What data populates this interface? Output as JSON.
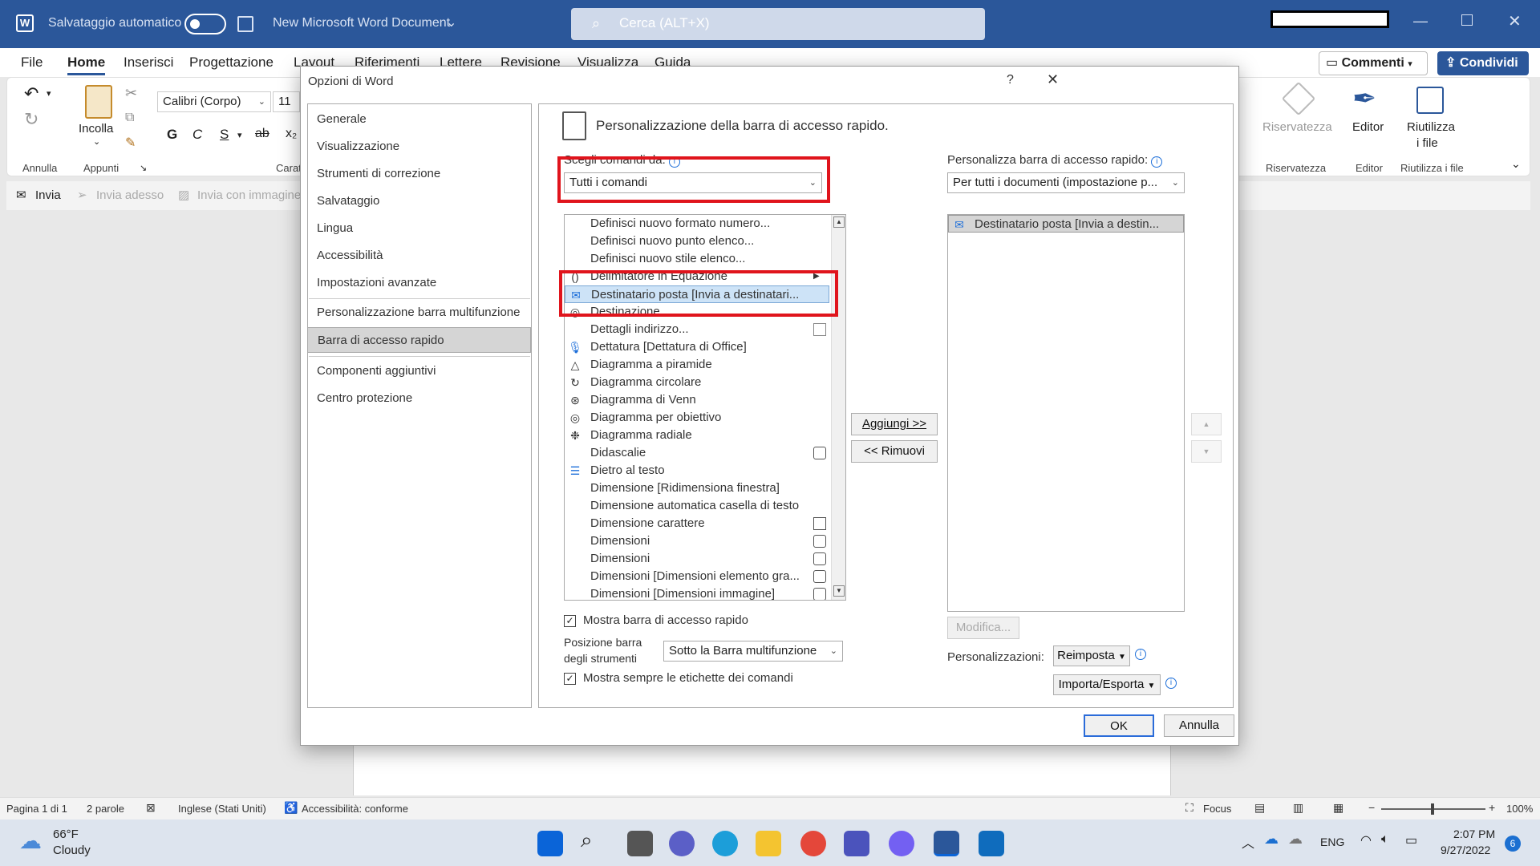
{
  "titlebar": {
    "autosave_label": "Salvataggio automatico",
    "doc_title": "New Microsoft Word Document",
    "search_placeholder": "Cerca (ALT+X)"
  },
  "tabs": [
    "File",
    "Home",
    "Inserisci",
    "Progettazione",
    "Layout",
    "Riferimenti",
    "Lettere",
    "Revisione",
    "Visualizza",
    "Guida"
  ],
  "ribbon": {
    "comments": "Commenti",
    "share": "Condividi",
    "undo_group": "Annulla",
    "paste": "Incolla",
    "clipboard_group": "Appunti",
    "font_name": "Calibri (Corpo)",
    "font_size": "11",
    "font_group_short": "Carat",
    "privacy": "Riservatezza",
    "privacy_group": "Riservatezza",
    "editor": "Editor",
    "editor_group": "Editor",
    "reuse_line1": "Riutilizza",
    "reuse_line2": "i file",
    "reuse_group": "Riutilizza i file"
  },
  "qat": [
    "Invia",
    "Invia adesso",
    "Invia con immagine"
  ],
  "dialog": {
    "title": "Opzioni di Word",
    "help": "?",
    "nav": [
      "Generale",
      "Visualizzazione",
      "Strumenti di correzione",
      "Salvataggio",
      "Lingua",
      "Accessibilità",
      "Impostazioni avanzate",
      "Personalizzazione barra multifunzione",
      "Barra di accesso rapido",
      "Componenti aggiuntivi",
      "Centro protezione"
    ],
    "heading": "Personalizzazione della barra di accesso rapido.",
    "choose_label": "Scegli comandi da:",
    "choose_value": "Tutti i comandi",
    "customize_label": "Personalizza barra di accesso rapido:",
    "customize_value": "Per tutti i documenti (impostazione p...",
    "commands": [
      "Definisci nuovo formato numero...",
      "Definisci nuovo punto elenco...",
      "Definisci nuovo stile elenco...",
      "Delimitatore in Equazione",
      "Destinatario posta [Invia a destinatari...",
      "Destinazione",
      "Dettagli indirizzo...",
      "Dettatura [Dettatura di Office]",
      "Diagramma a piramide",
      "Diagramma circolare",
      "Diagramma di Venn",
      "Diagramma per obiettivo",
      "Diagramma radiale",
      "Didascalie",
      "Dietro al testo",
      "Dimensione [Ridimensiona finestra]",
      "Dimensione automatica casella di testo",
      "Dimensione carattere",
      "Dimensioni",
      "Dimensioni",
      "Dimensioni [Dimensioni elemento gra...",
      "Dimensioni [Dimensioni immagine]"
    ],
    "qat_items": [
      "Destinatario posta [Invia a destin..."
    ],
    "add": "Aggiungi >>",
    "remove": "<< Rimuovi",
    "modify": "Modifica...",
    "show_qat": "Mostra barra di accesso rapido",
    "position_label_1": "Posizione barra",
    "position_label_2": "degli strumenti",
    "position_value": "Sotto la Barra multifunzione",
    "show_labels": "Mostra sempre le etichette dei comandi",
    "customizations_label": "Personalizzazioni:",
    "reset": "Reimposta",
    "import_export": "Importa/Esporta",
    "ok": "OK",
    "cancel": "Annulla"
  },
  "status": {
    "page": "Pagina 1 di 1",
    "words": "2 parole",
    "language": "Inglese (Stati Uniti)",
    "accessibility": "Accessibilità: conforme",
    "focus": "Focus",
    "zoom": "100%"
  },
  "taskbar": {
    "temp": "66°F",
    "weather": "Cloudy",
    "lang": "ENG",
    "time": "2:07 PM",
    "date": "9/27/2022",
    "notif": "6"
  },
  "colors": {
    "brand": "#2b579a",
    "highlight": "#e0141c"
  }
}
